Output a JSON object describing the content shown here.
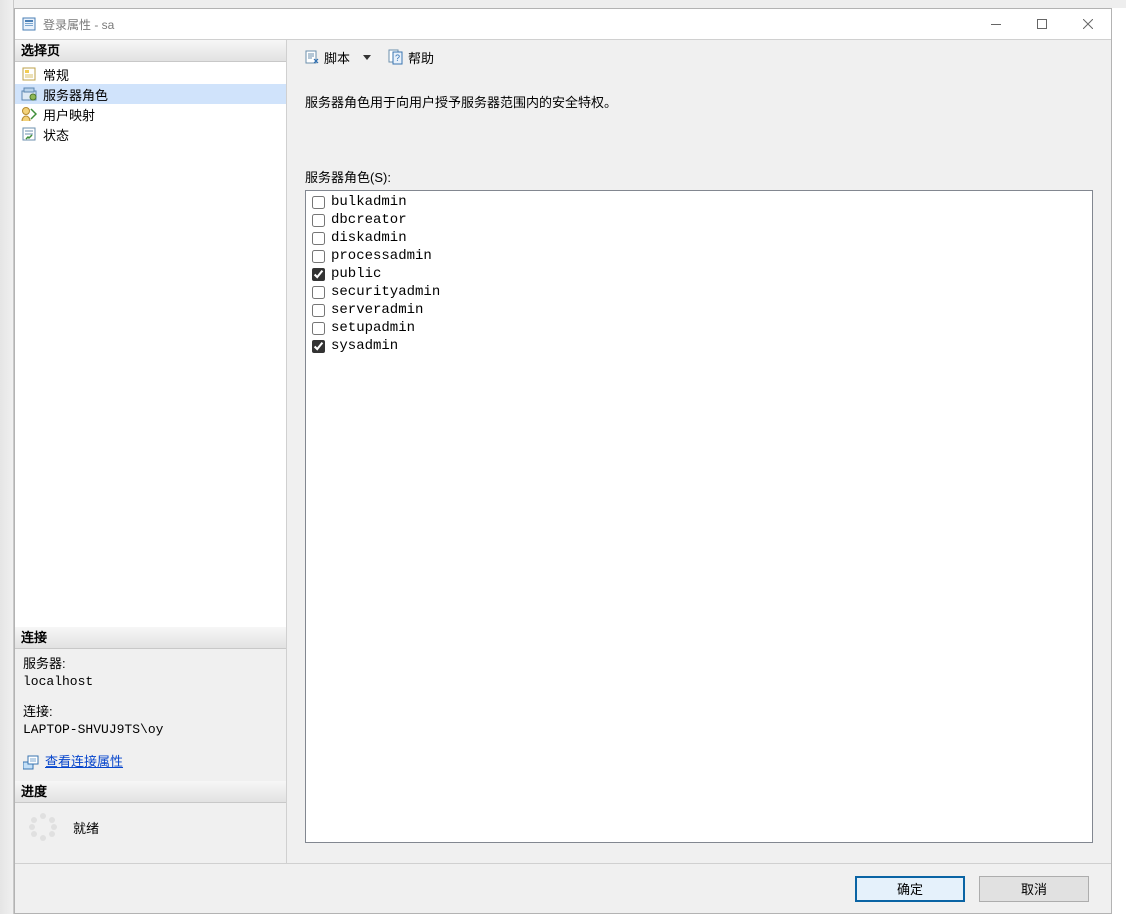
{
  "window": {
    "title": "登录属性 - sa"
  },
  "sidebar": {
    "select_page_header": "选择页",
    "pages": [
      {
        "label": "常规",
        "selected": false
      },
      {
        "label": "服务器角色",
        "selected": true
      },
      {
        "label": "用户映射",
        "selected": false
      },
      {
        "label": "状态",
        "selected": false
      }
    ],
    "connection_header": "连接",
    "server_label": "服务器:",
    "server_value": "localhost",
    "connection_label": "连接:",
    "connection_value": "LAPTOP-SHVUJ9TS\\oy",
    "view_connection_properties": "查看连接属性",
    "progress_header": "进度",
    "progress_status": "就绪"
  },
  "toolbar": {
    "script_label": "脚本",
    "help_label": "帮助"
  },
  "main": {
    "description": "服务器角色用于向用户授予服务器范围内的安全特权。",
    "roles_label": "服务器角色(S):",
    "roles": [
      {
        "name": "bulkadmin",
        "checked": false
      },
      {
        "name": "dbcreator",
        "checked": false
      },
      {
        "name": "diskadmin",
        "checked": false
      },
      {
        "name": "processadmin",
        "checked": false
      },
      {
        "name": "public",
        "checked": true
      },
      {
        "name": "securityadmin",
        "checked": false
      },
      {
        "name": "serveradmin",
        "checked": false
      },
      {
        "name": "setupadmin",
        "checked": false
      },
      {
        "name": "sysadmin",
        "checked": true
      }
    ]
  },
  "footer": {
    "ok_label": "确定",
    "cancel_label": "取消"
  }
}
